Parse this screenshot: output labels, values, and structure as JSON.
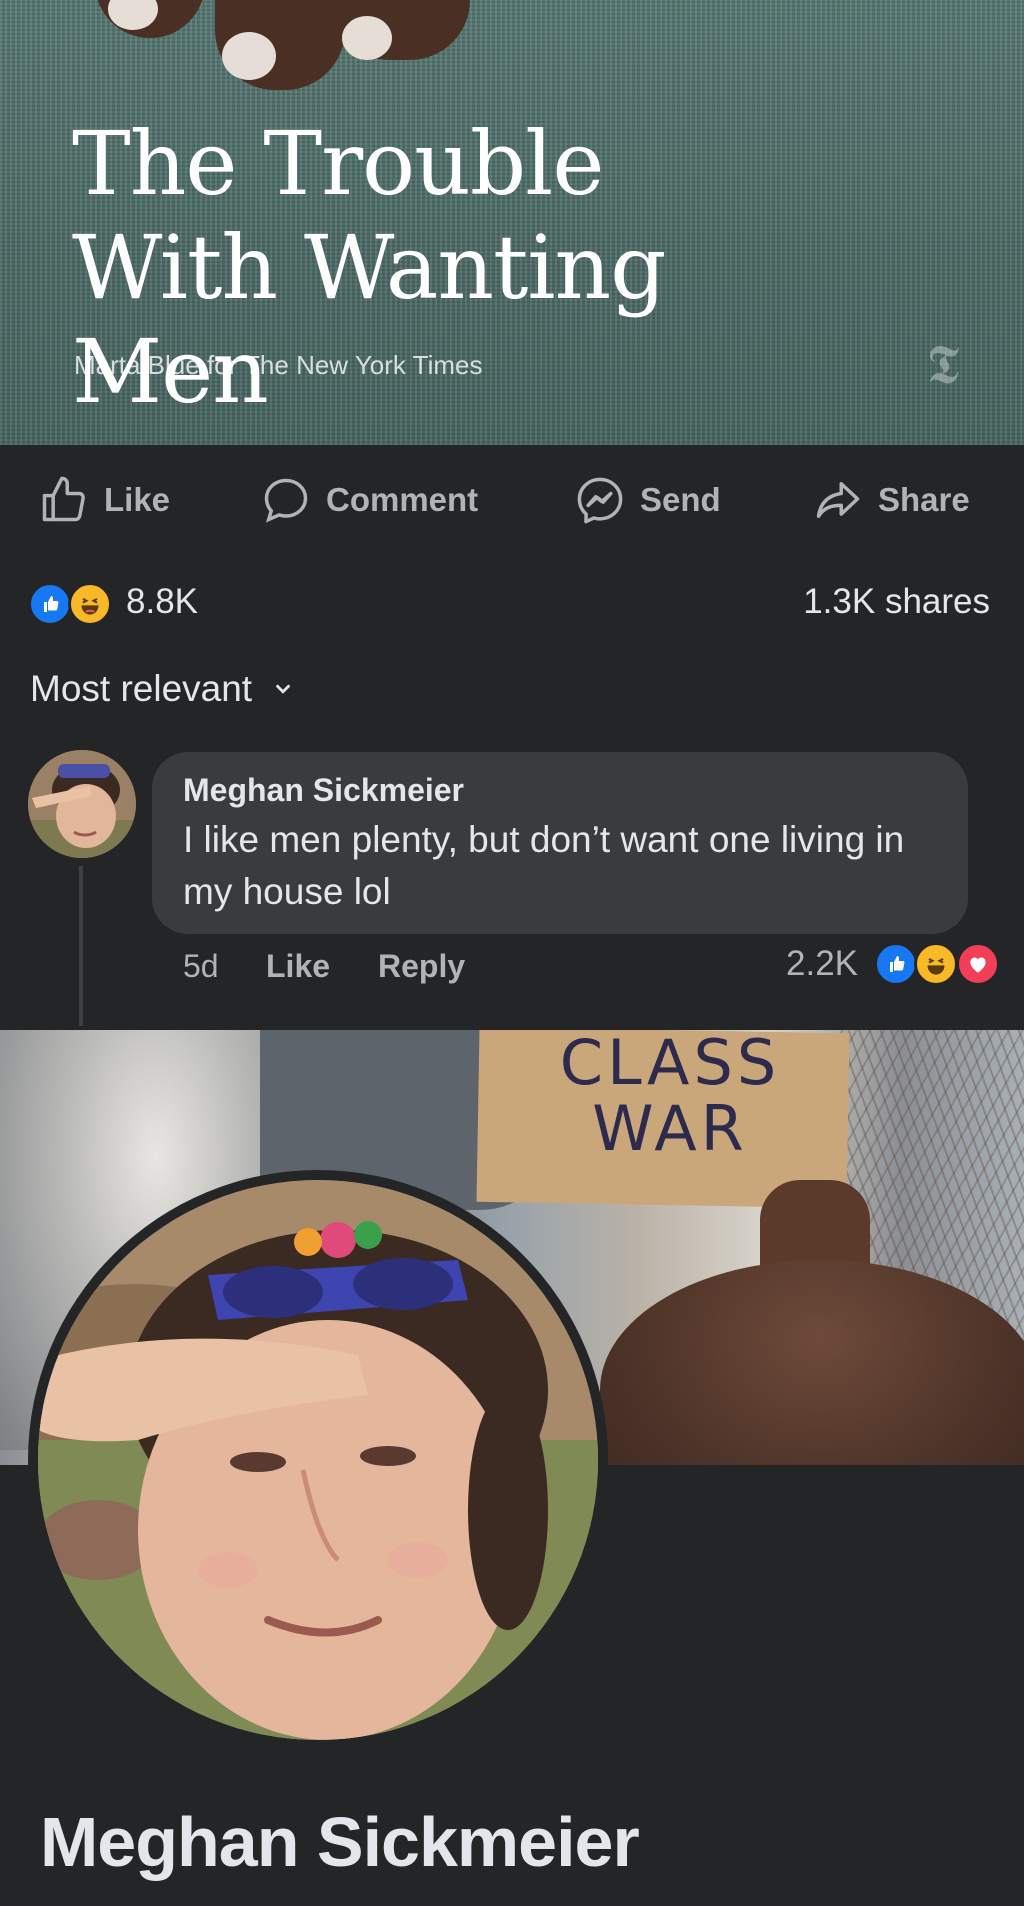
{
  "article": {
    "title": "The Trouble With Wanting Men",
    "photo_credit": "Marta Blue for The New York Times",
    "publisher_logo": "nyt-t-logo"
  },
  "actions": {
    "like": "Like",
    "comment": "Comment",
    "send": "Send",
    "share": "Share"
  },
  "stats": {
    "reactions_total": "8.8K",
    "shares": "1.3K shares",
    "reaction_icons": [
      "like",
      "haha"
    ]
  },
  "sort": {
    "label": "Most relevant"
  },
  "comment": {
    "author": "Meghan Sickmeier",
    "text": "I like men plenty, but don’t want one living in my house lol",
    "age": "5d",
    "like_label": "Like",
    "reply_label": "Reply",
    "reaction_count": "2.2K",
    "reaction_icons": [
      "like",
      "haha",
      "love"
    ]
  },
  "cover": {
    "sign_text": "CLASS WAR"
  },
  "profile": {
    "name": "Meghan Sickmeier"
  },
  "colors": {
    "background": "#242526",
    "bubble": "#3a3b3c",
    "like_blue": "#1877f2",
    "haha_yellow": "#f7b928",
    "love_red": "#f33e58"
  }
}
